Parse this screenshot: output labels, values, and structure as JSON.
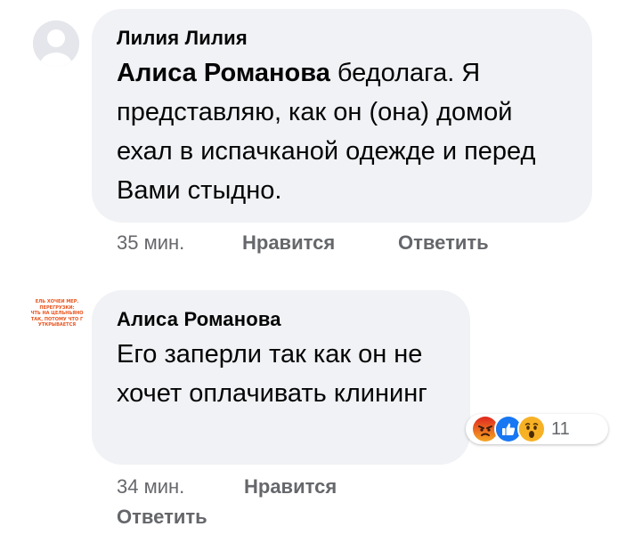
{
  "comments": [
    {
      "author": "Лилия Лилия",
      "mention": "Алиса Романова",
      "text_after_mention": " бедолага. Я представляю, как он (она) домой ехал в испачканой одежде и перед Вами стыдно.",
      "time": "35 мин.",
      "like_label": "Нравится",
      "reply_label": "Ответить",
      "avatar": "default-profile-silhouette"
    },
    {
      "author": "Алиса Романова",
      "text": "Его заперли так как он не хочет оплачивать клининг",
      "time": "34 мин.",
      "like_label": "Нравится",
      "reply_label": "Ответить",
      "avatar": "text-image",
      "avatar_lines": [
        "ЕЛЬ ХОЧЕЙ МЕР.",
        "ПЕРЕГРУЗКИ:",
        "ЧТЬ НА ЦЕЛЬНЬЯНО",
        "ТАК, ПОТОМУ ЧТО Г",
        "УТКРЫВАЕТСЯ"
      ],
      "reactions": {
        "icons": [
          "angry-reaction-icon",
          "like-reaction-icon",
          "wow-reaction-icon"
        ],
        "count": "11"
      }
    }
  ],
  "colors": {
    "bubble": "#f0f2f5",
    "meta_text": "#65676b",
    "like_blue": "#1877f2",
    "angry_red": "#e9710f",
    "wow_yellow": "#f7b125"
  }
}
